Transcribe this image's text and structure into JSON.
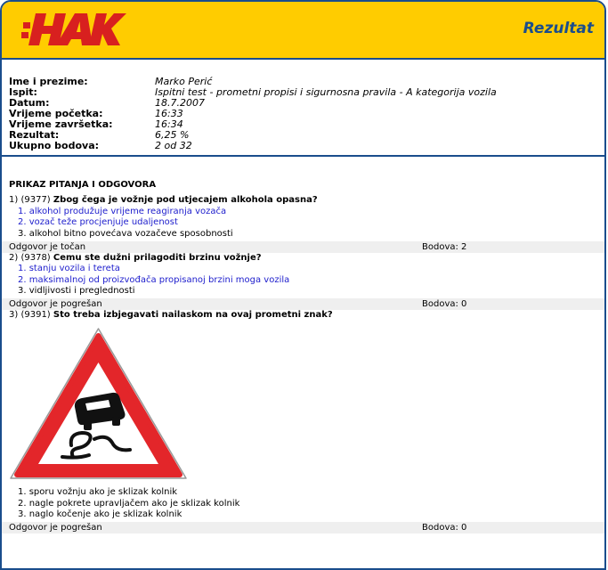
{
  "header": {
    "logo_text": "HAK",
    "title": "Rezultat",
    "logo_color": "#d8201f",
    "brand_color": "#1a4d8c",
    "accent_bg": "#ffcc00"
  },
  "info": [
    {
      "label": "Ime i prezime:",
      "value": "Marko Perić"
    },
    {
      "label": "Ispit:",
      "value": "Ispitni test - prometni propisi i sigurnosna pravila - A kategorija vozila"
    },
    {
      "label": "Datum:",
      "value": "18.7.2007"
    },
    {
      "label": "Vrijeme početka:",
      "value": "16:33"
    },
    {
      "label": "Vrijeme završetka:",
      "value": "16:34"
    },
    {
      "label": "Rezultat:",
      "value": "6,25 %"
    },
    {
      "label": "Ukupno bodova:",
      "value": "2 od 32"
    }
  ],
  "section_title": "PRIKAZ PITANJA I ODGOVORA",
  "questions": [
    {
      "num": "1)",
      "id": "(9377)",
      "text": "Zbog čega je vožnje pod utjecajem alkohola opasna?",
      "answers": [
        "1. alkohol produžuje vrijeme reagiranja vozača",
        "2. vozač teže procjenjuje udaljenost",
        "3. alkohol bitno povećava vozačeve sposobnosti"
      ],
      "result": "Odgovor je točan",
      "points": "Bodova:  2"
    },
    {
      "num": "2)",
      "id": "(9378)",
      "text": "Čemu ste dužni prilagoditi brzinu vožnje?",
      "answers": [
        "1. stanju vozila i tereta",
        "2. maksimalnoj od proizvođača propisanoj brzini moga vozila",
        "3. vidljivosti i preglednosti"
      ],
      "result": "Odgovor je pogrešan",
      "points": "Bodova:  0"
    },
    {
      "num": "3)",
      "id": "(9391)",
      "text": "Što treba izbjegavati nailaskom na ovaj prometni znak?",
      "image_icon": "slippery-road-sign-icon",
      "answers": [
        "1. sporu vožnju ako je sklizak kolnik",
        "2. nagle pokrete upravljačem ako je sklizak kolnik",
        "3. naglo kočenje ako je sklizak kolnik"
      ],
      "result": "Odgovor je pogrešan",
      "points": "Bodova:  0"
    }
  ]
}
